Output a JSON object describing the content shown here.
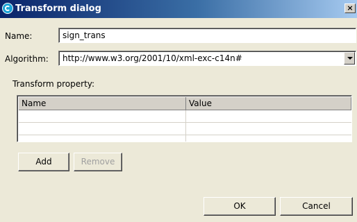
{
  "window": {
    "title": "Transform dialog",
    "close_glyph": "×"
  },
  "name_field": {
    "label": "Name:",
    "value": "sign_trans"
  },
  "algorithm_field": {
    "label": "Algorithm:",
    "value": "http://www.w3.org/2001/10/xml-exc-c14n#"
  },
  "transform_property": {
    "label": "Transform property:",
    "columns": [
      "Name",
      "Value"
    ],
    "rows": [
      [
        "",
        ""
      ],
      [
        "",
        ""
      ],
      [
        "",
        ""
      ]
    ]
  },
  "buttons": {
    "add": "Add",
    "remove": "Remove",
    "ok": "OK",
    "cancel": "Cancel"
  }
}
